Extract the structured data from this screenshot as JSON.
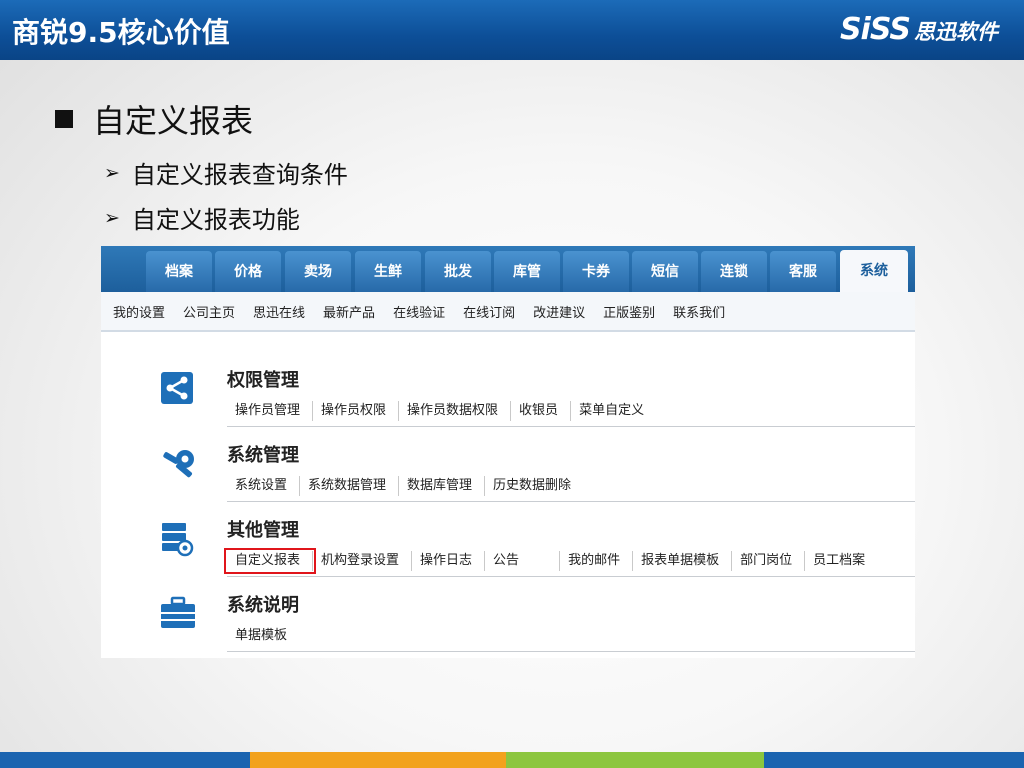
{
  "header": {
    "title": "商锐9.5核心价值",
    "logo_brand": "SiSS",
    "logo_name": "思迅软件"
  },
  "bullets": {
    "main": "自定义报表",
    "sub": [
      "自定义报表查询条件",
      "自定义报表功能"
    ]
  },
  "app": {
    "tabs": [
      "档案",
      "价格",
      "卖场",
      "生鲜",
      "批发",
      "库管",
      "卡券",
      "短信",
      "连锁",
      "客服",
      "系统"
    ],
    "active_tab": "系统",
    "subnav": [
      "我的设置",
      "公司主页",
      "思迅在线",
      "最新产品",
      "在线验证",
      "在线订阅",
      "改进建议",
      "正版鉴别",
      "联系我们"
    ],
    "sections": [
      {
        "title": "权限管理",
        "links": [
          "操作员管理",
          "操作员权限",
          "操作员数据权限",
          "收银员",
          "菜单自定义"
        ]
      },
      {
        "title": "系统管理",
        "links": [
          "系统设置",
          "系统数据管理",
          "数据库管理",
          "历史数据删除"
        ]
      },
      {
        "title": "其他管理",
        "links": [
          "自定义报表",
          "机构登录设置",
          "操作日志",
          "公告",
          "我的邮件",
          "报表单据模板",
          "部门岗位",
          "员工档案"
        ]
      },
      {
        "title": "系统说明",
        "links": [
          "单据模板"
        ]
      }
    ],
    "highlighted_link": "自定义报表"
  },
  "colors": {
    "header_blue": "#0d4f98",
    "tab_blue": "#276aa9",
    "highlight_red": "#e0151b",
    "bottom_bar": [
      "#1b64b0",
      "#f2a21d",
      "#8cc63f",
      "#1b64b0"
    ]
  }
}
